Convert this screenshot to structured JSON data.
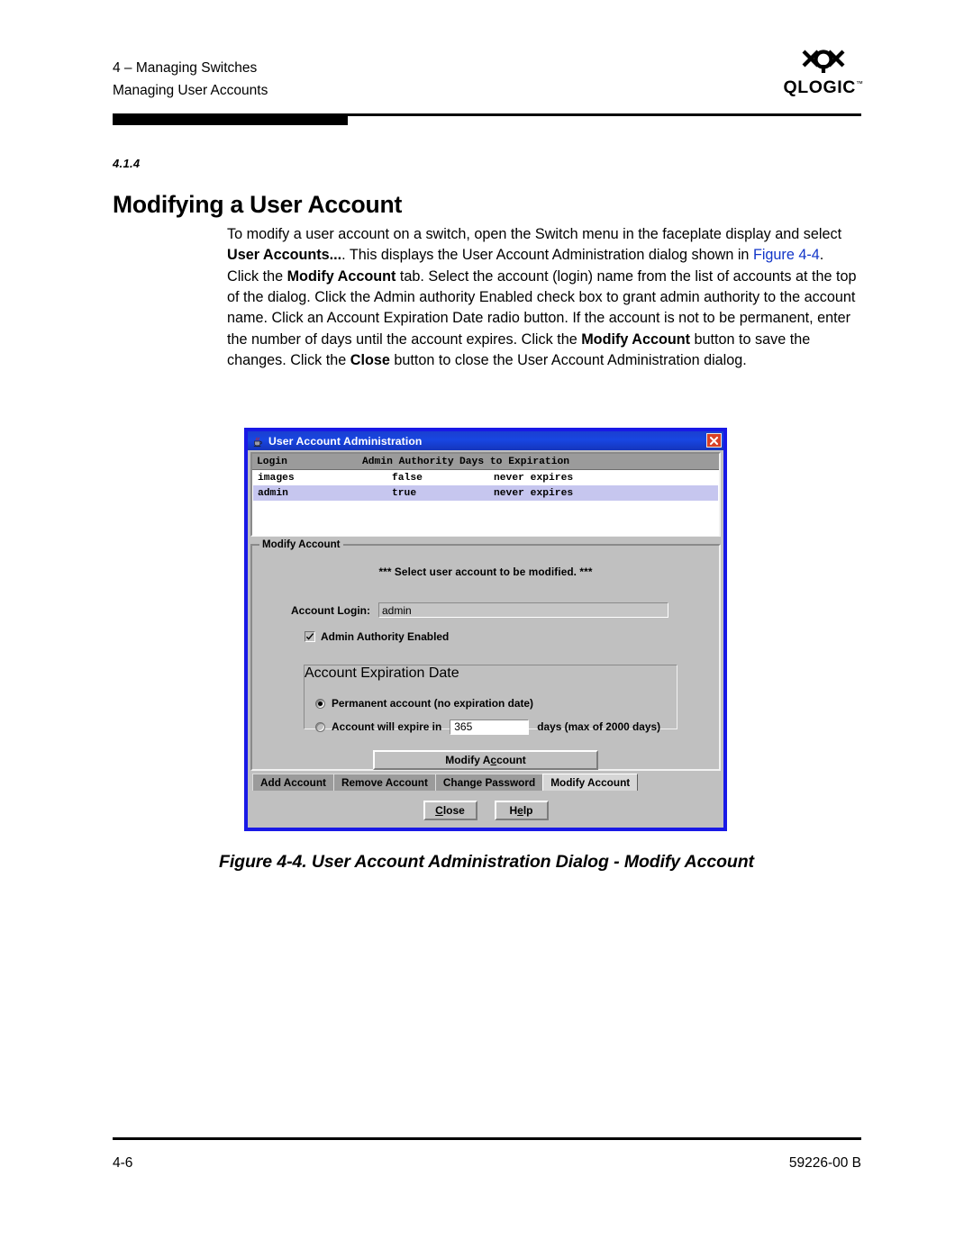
{
  "header": {
    "chapter_line": "4 – Managing Switches",
    "section_line": "Managing User Accounts",
    "logo_word": "QLOGIC",
    "logo_tm": "™"
  },
  "section": {
    "number": "4.1.4",
    "title": "Modifying a User Account"
  },
  "body": {
    "part1": "To modify a user account on a switch, open the Switch menu in the faceplate display and select ",
    "bold1": "User Accounts...",
    "part2": ". This displays the User Account Administration dialog shown in ",
    "xref": "Figure 4-4",
    "part3": ". Click the ",
    "bold2": "Modify Account",
    "part4": " tab. Select the account (login) name from the list of accounts at the top of the dialog. Click the Admin authority Enabled check box to grant admin authority to the account name. Click an Account Expiration Date radio button. If the account is not to be permanent, enter the number of days until the account expires. Click the ",
    "bold3": "Modify Account",
    "part5": " button to save the changes. Click the ",
    "bold4": "Close",
    "part6": " button to close the User Account Administration dialog."
  },
  "dialog": {
    "title": "User Account Administration",
    "close_icon": "close-x-icon",
    "app_icon": "java-coffee-cup-icon",
    "table": {
      "columns": [
        "Login",
        "Admin Authority",
        "Days to Expiration"
      ],
      "rows": [
        {
          "login": "images",
          "authority": "false",
          "expiration": "never expires",
          "selected": false
        },
        {
          "login": "admin",
          "authority": "true",
          "expiration": "never expires",
          "selected": true
        }
      ]
    },
    "panel": {
      "title": "Modify Account",
      "hint": "*** Select user account to be modified. ***",
      "account_login_label": "Account Login:",
      "account_login_value": "admin",
      "admin_authority_label": "Admin Authority Enabled",
      "admin_authority_checked": true,
      "expiration": {
        "title": "Account Expiration Date",
        "option_permanent": "Permanent account (no expiration date)",
        "option_permanent_selected": true,
        "option_expire_label": "Account will expire in",
        "option_expire_selected": false,
        "days_value": "365",
        "days_suffix": "days (max of 2000 days)"
      },
      "action_button": "Modify Account",
      "action_button_mnemonic": "c"
    },
    "tabs": [
      {
        "label": "Add Account",
        "active": false
      },
      {
        "label": "Remove Account",
        "active": false
      },
      {
        "label": "Change Password",
        "active": false
      },
      {
        "label": "Modify Account",
        "active": true
      }
    ],
    "footer_buttons": [
      {
        "label": "Close",
        "mnemonic": "C"
      },
      {
        "label": "Help",
        "mnemonic": "e"
      }
    ]
  },
  "figure": {
    "caption": "Figure 4-4.  User Account Administration Dialog - Modify Account"
  },
  "footer": {
    "page_number": "4-6",
    "doc_number": "59226-00 B"
  },
  "colors": {
    "titlebar_blue": "#1846e2",
    "dialog_border": "#1919e6",
    "face_gray": "#c0c0c0",
    "selection_blue": "#c6c6ef",
    "link_blue": "#1034C8",
    "close_red": "#d94126"
  }
}
